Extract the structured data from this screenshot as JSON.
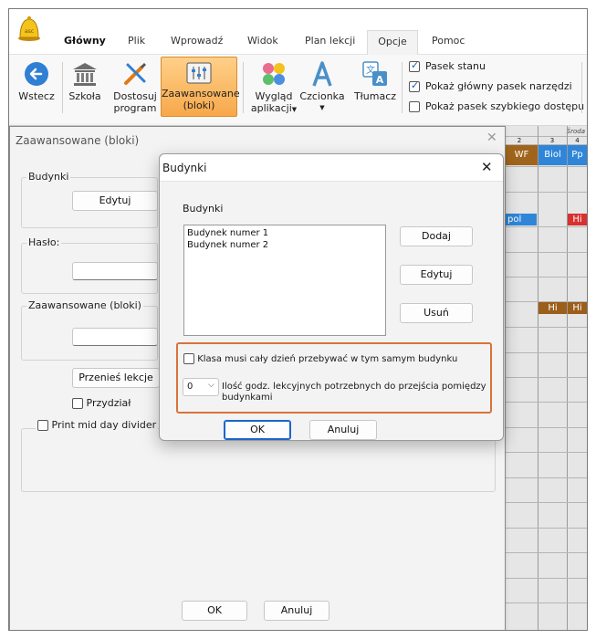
{
  "ribbon_tabs": [
    "Główny",
    "Plik",
    "Wprowadź",
    "Widok",
    "Plan lekcji",
    "Opcje",
    "Pomoc"
  ],
  "logo_text": "asc",
  "ribbon": {
    "back": "Wstecz",
    "school": "Szkoła",
    "customize_line1": "Dostosuj",
    "customize_line2": "program",
    "advanced_line1": "Zaawansowane",
    "advanced_line2": "(bloki)",
    "appearance_line1": "Wygląd",
    "appearance_line2": "aplikacji",
    "font": "Czcionka",
    "translator": "Tłumacz",
    "opt_status_bar": "Pasek stanu",
    "opt_main_toolbar": "Pokaż główny pasek narzędzi",
    "opt_quick_toolbar": "Pokaż pasek szybkiego dostępu"
  },
  "timetable": {
    "day": "Środa",
    "columns": [
      "2",
      "3",
      "4"
    ],
    "row1": [
      "WF",
      "Biol",
      "Pp"
    ],
    "row2": [
      "pol",
      "",
      "Hi"
    ],
    "row3": [
      "",
      "Hi",
      "Hi"
    ]
  },
  "adv_window": {
    "title": "Zaawansowane (bloki)",
    "buildings_group": "Budynki",
    "edit_button": "Edytuj",
    "password_group": "Hasło:",
    "advanced_group": "Zaawansowane (bloki)",
    "move_lessons": "Przenieś lekcje",
    "assignment": "Przydział",
    "print_divider": "Print mid day divider",
    "ok": "OK",
    "cancel": "Anuluj"
  },
  "dlg": {
    "title": "Budynki",
    "section_label": "Budynki",
    "buildings": [
      "Budynek numer 1",
      "Budynek numer 2"
    ],
    "add": "Dodaj",
    "edit": "Edytuj",
    "delete": "Usuń",
    "same_building_label": "Klasa musi cały dzień przebywać w tym samym budynku",
    "hours_value": "0",
    "hours_label_line1": "Ilość godz. lekcyjnych potrzebnych do przejścia pomiędzy",
    "hours_label_line2": "budynkami",
    "ok": "OK",
    "cancel": "Anuluj"
  },
  "colors": {
    "wf": "#a0651c",
    "biol": "#2f86d8",
    "pp": "#2f86d8",
    "pol": "#2f86d8",
    "hi_red": "#d93030",
    "hi_brown": "#9b5e1b",
    "accent_orange": "#d9733a",
    "accent_blue": "#1a66c9"
  }
}
